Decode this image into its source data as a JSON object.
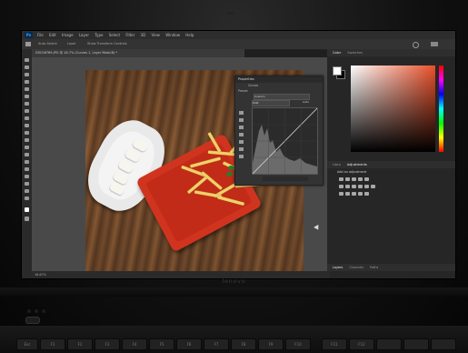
{
  "menu": {
    "app_logo": "Ps",
    "items": [
      "File",
      "Edit",
      "Image",
      "Layer",
      "Type",
      "Select",
      "Filter",
      "3D",
      "View",
      "Window",
      "Help"
    ]
  },
  "options_bar": {
    "auto_select": "Auto-Select:",
    "layer": "Layer",
    "show_transform": "Show Transform Controls"
  },
  "document": {
    "tab_title": "DSC08769.JPG @ 16.7% (Curves 1, Layer Mask/8) *",
    "zoom": "16.67%"
  },
  "properties_panel": {
    "title": "Properties",
    "subtitle": "Curves",
    "preset_label": "Preset:",
    "preset_value": "Custom",
    "channel_value": "RGB",
    "auto_label": "Auto"
  },
  "color_panel": {
    "tab_color": "Color",
    "tab_swatches": "Swatches"
  },
  "adjustments_panel": {
    "tab_libraries": "Libra",
    "tab_adjustments": "Adjustments",
    "add_label": "Add an adjustment"
  },
  "layers_panel": {
    "tab_layers": "Layers",
    "tab_channels": "Channels",
    "tab_paths": "Paths"
  },
  "laptop": {
    "brand": "lenovo"
  },
  "keyboard": {
    "keys": [
      "Esc",
      "F1",
      "F2",
      "F3",
      "F4",
      "F5",
      "F6",
      "F7",
      "F8",
      "F9",
      "F10",
      "F11",
      "F12"
    ]
  },
  "colors": {
    "accent_red": "#e8502a",
    "plate_red": "#d0341f",
    "ps_blue": "#31a8ff"
  }
}
